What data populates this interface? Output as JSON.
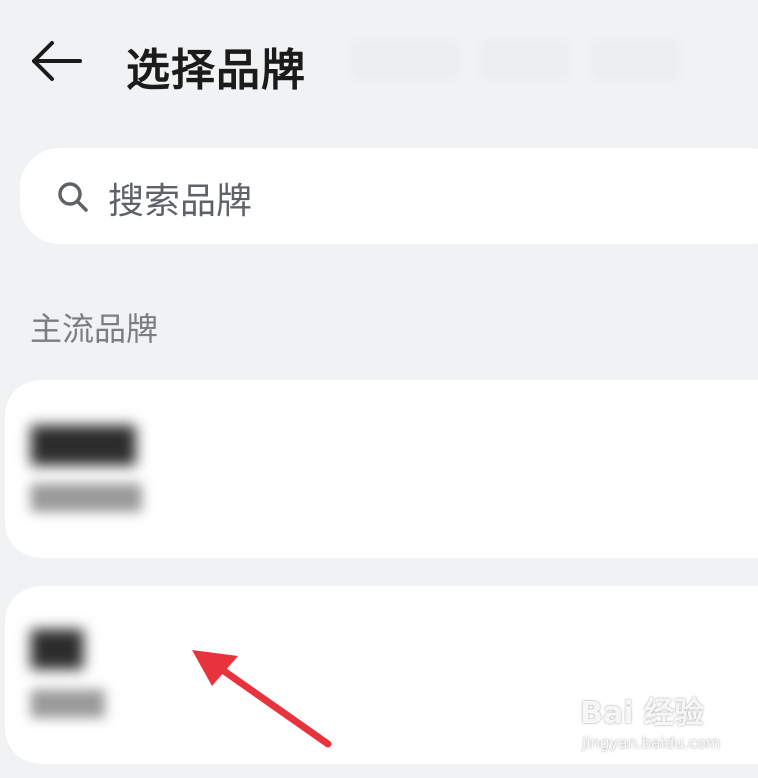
{
  "header": {
    "title": "选择品牌",
    "back_icon": "arrow-left-icon"
  },
  "search": {
    "placeholder": "搜索品牌",
    "icon": "search-icon"
  },
  "section": {
    "label": "主流品牌"
  },
  "brands": [
    {
      "name": "████",
      "subtitle": "██████"
    },
    {
      "name": "██",
      "subtitle": "████"
    }
  ],
  "annotation": {
    "type": "red-arrow",
    "color": "#e8323c",
    "points_to": "second brand card"
  },
  "watermark": {
    "main": "Bai 经验",
    "url": "jingyan.baidu.com"
  },
  "colors": {
    "background": "#f1f2f4",
    "card": "#ffffff",
    "title": "#1b1b1b",
    "muted": "#7a7d82",
    "arrow": "#e8323c"
  }
}
